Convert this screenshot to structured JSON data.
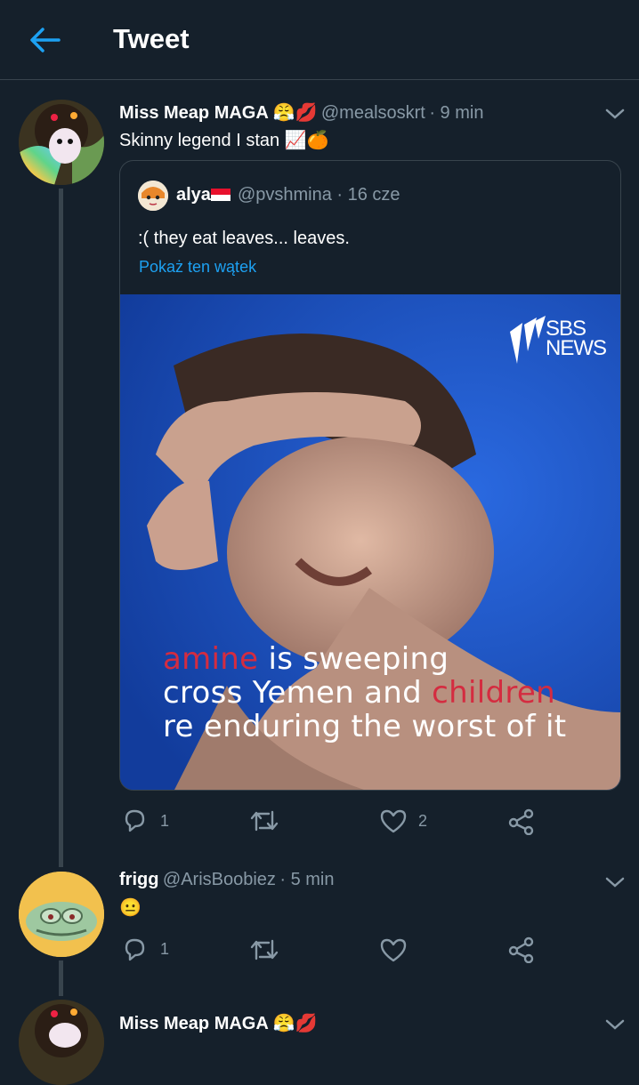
{
  "header": {
    "title": "Tweet"
  },
  "tweets": [
    {
      "name": "Miss Meap MAGA 😤💋",
      "handle": "@mealsoskrt",
      "time": "· 9 min",
      "text": "Skinny legend I stan 📈🍊",
      "reply_count": "1",
      "retweet_count": "",
      "like_count": "2",
      "quoted": {
        "name": "alya",
        "flag": "🇮🇩",
        "handle": "@pvshmina",
        "time": "· 16 cze",
        "text": ":( they eat leaves... leaves.",
        "show_thread": "Pokaż ten wątek",
        "media": {
          "logo_line1": "SBS",
          "logo_line2": "NEWS",
          "caption_line1_red": "amine",
          "caption_line1_white": " is sweeping",
          "caption_line2_white": "cross Yemen and ",
          "caption_line2_red": "children",
          "caption_line3_white": "re enduring the worst of it"
        }
      }
    },
    {
      "name": "frigg",
      "handle": "@ArisBoobiez",
      "time": "· 5 min",
      "text": "😐",
      "reply_count": "1",
      "retweet_count": "",
      "like_count": ""
    },
    {
      "name": "Miss Meap MAGA 😤💋"
    }
  ],
  "colors": {
    "background": "#15202b",
    "accent": "#1da1f2",
    "secondary_text": "#8899a6",
    "border": "#38444d"
  }
}
